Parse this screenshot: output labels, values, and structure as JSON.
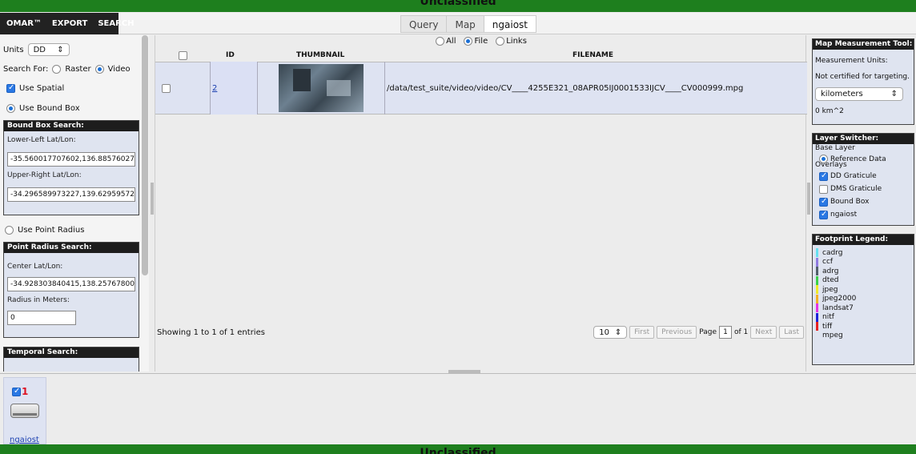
{
  "banner": {
    "top": "Unclassified",
    "bottom": "Unclassified"
  },
  "nav": {
    "brand": "OMAR™",
    "export": "EXPORT",
    "search": "SEARCH"
  },
  "tabs": [
    "Query",
    "Map",
    "ngaiost"
  ],
  "left": {
    "units_label": "Units",
    "units_value": "DD",
    "search_for_label": "Search For:",
    "raster_label": "Raster",
    "video_label": "Video",
    "use_spatial": "Use Spatial",
    "use_bound_box": "Use Bound Box",
    "bound_box": {
      "title": "Bound Box Search:",
      "lower_left_label": "Lower-Left Lat/Lon:",
      "lower_left_value": "-35.560017707602,136.88576027",
      "upper_right_label": "Upper-Right Lat/Lon:",
      "upper_right_value": "-34.296589973227,139.62959572"
    },
    "use_point_radius": "Use Point Radius",
    "point_radius": {
      "title": "Point Radius Search:",
      "center_label": "Center Lat/Lon:",
      "center_value": "-34.928303840415,138.25767800",
      "radius_label": "Radius in Meters:",
      "radius_value": "0"
    },
    "temporal": {
      "title": "Temporal Search:"
    }
  },
  "results": {
    "view_modes": [
      "All",
      "File",
      "Links"
    ],
    "selected_view": "File",
    "columns": {
      "id": "ID",
      "thumbnail": "THUMBNAIL",
      "filename": "FILENAME"
    },
    "rows": [
      {
        "id": "2",
        "filename": "/data/test_suite/video/video/CV____4255E321_08APR05IJ0001533IJCV____CV000999.mpg"
      }
    ],
    "showing": "Showing 1 to 1 of 1 entries",
    "page_size": "10",
    "pager": {
      "first": "First",
      "previous": "Previous",
      "page_label": "Page",
      "page": "1",
      "of_label": "of 1",
      "next": "Next",
      "last": "Last"
    }
  },
  "right": {
    "measure": {
      "title": "Map Measurement Tool:",
      "units_label": "Measurement Units:",
      "note": "Not certified for targeting.",
      "unit_value": "kilometers",
      "area": "0 km^2"
    },
    "layer_switcher": {
      "title": "Layer Switcher:",
      "base_layer": "Base Layer",
      "reference": "Reference Data",
      "overlays": "Overlays",
      "overlay_items": [
        "DD Graticule",
        "DMS Graticule",
        "Bound Box",
        "ngaiost"
      ]
    },
    "legend": {
      "title": "Footprint Legend:",
      "items": [
        {
          "label": "cadrg",
          "color": "#66e0f0"
        },
        {
          "label": "ccf",
          "color": "#8f7be0"
        },
        {
          "label": "adrg",
          "color": "#52606b"
        },
        {
          "label": "dted",
          "color": "#3bd14a"
        },
        {
          "label": "jpeg",
          "color": "#f0ea28"
        },
        {
          "label": "jpeg2000",
          "color": "#f2b125"
        },
        {
          "label": "landsat7",
          "color": "#e532e5"
        },
        {
          "label": "nitf",
          "color": "#1c22d8"
        },
        {
          "label": "tiff",
          "color": "#e62020"
        },
        {
          "label": "mpeg",
          "color": "#dfe4f0"
        }
      ]
    }
  },
  "bottom": {
    "count": "1",
    "layer": "ngaiost"
  }
}
